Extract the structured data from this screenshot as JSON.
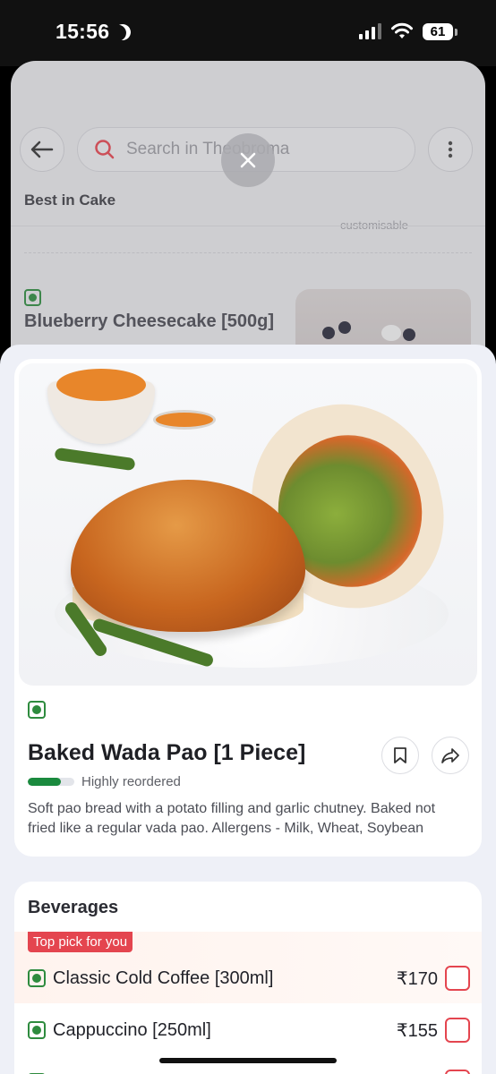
{
  "status_bar": {
    "time": "15:56",
    "battery": "61"
  },
  "background": {
    "search_placeholder": "Search in Theobroma",
    "section_title": "Best in Cake",
    "customisable_note": "customisable",
    "item_name": "Blueberry Cheesecake [500g]"
  },
  "product": {
    "title": "Baked Wada Pao [1 Piece]",
    "reorder_label": "Highly reordered",
    "reorder_level": 0.72,
    "description": "Soft pao bread with a potato filling and garlic chutney. Baked not fried like a regular vada pao. Allergens - Milk, Wheat, Soybean"
  },
  "beverages": {
    "title": "Beverages",
    "top_pick_label": "Top pick for you",
    "items": [
      {
        "name": "Classic Cold Coffee [300ml]",
        "price": "₹170"
      },
      {
        "name": "Cappuccino [250ml]",
        "price": "₹155"
      }
    ]
  },
  "colors": {
    "accent": "#e4454f",
    "veg_green": "#2e8b3e"
  },
  "icons": [
    "back-arrow-icon",
    "search-icon",
    "more-vertical-icon",
    "close-icon",
    "bookmark-icon",
    "share-icon",
    "veg-icon"
  ]
}
